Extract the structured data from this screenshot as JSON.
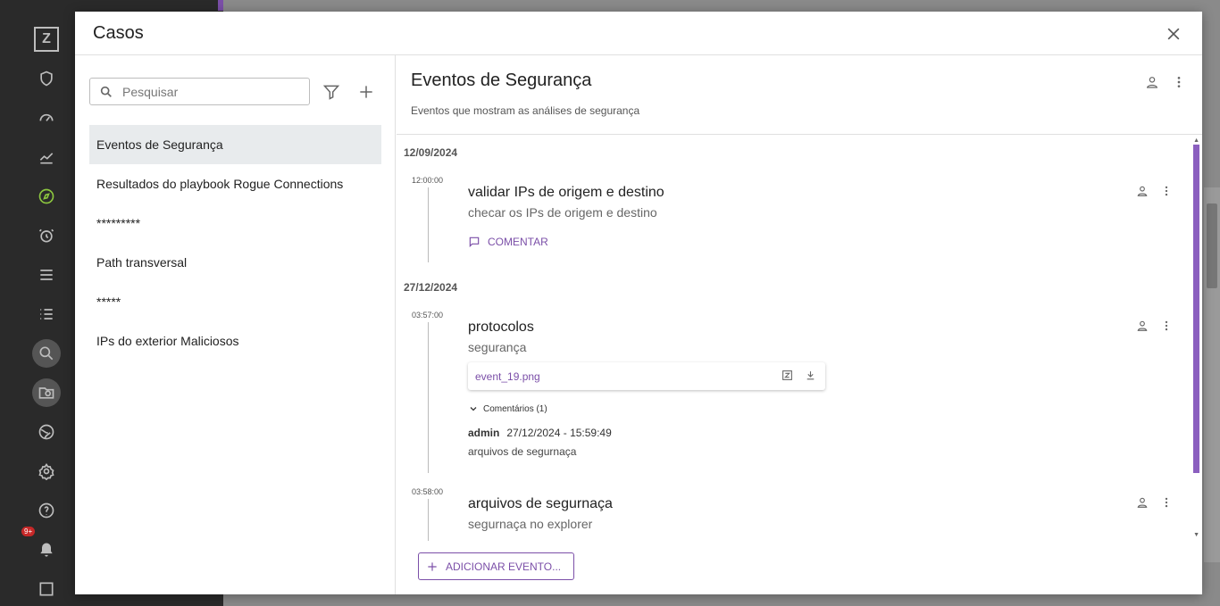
{
  "modal": {
    "title": "Casos"
  },
  "search": {
    "placeholder": "Pesquisar"
  },
  "cases": [
    {
      "label": "Eventos de Segurança",
      "active": true
    },
    {
      "label": "Resultados do playbook Rogue Connections"
    },
    {
      "label": "*********"
    },
    {
      "label": "Path transversal"
    },
    {
      "label": "*****"
    },
    {
      "label": "IPs do exterior Maliciosos"
    }
  ],
  "case_detail": {
    "title": "Eventos de Segurança",
    "description": "Eventos que mostram as análises de segurança"
  },
  "timeline": {
    "groups": [
      {
        "date": "12/09/2024",
        "events": [
          {
            "time": "12:00:00",
            "title": "validar IPs de origem e destino",
            "subtitle": "checar os IPs de origem e destino",
            "comment_label": "COMENTAR"
          }
        ]
      },
      {
        "date": "27/12/2024",
        "events": [
          {
            "time": "03:57:00",
            "title": "protocolos",
            "subtitle": "segurança",
            "file": "event_19.png",
            "comments_toggle": "Comentários (1)",
            "comment": {
              "author": "admin",
              "timestamp": "27/12/2024 - 15:59:49",
              "text": "arquivos de segurnaça"
            }
          },
          {
            "time": "03:58:00",
            "title": "arquivos de segurnaça",
            "subtitle": "segurnaça no explorer"
          }
        ]
      }
    ]
  },
  "add_event_label": "ADICIONAR EVENTO...",
  "background": {
    "notification_badge": "9+"
  },
  "colors": {
    "accent": "#7b4fa8",
    "active_item": "#e8ebed"
  }
}
